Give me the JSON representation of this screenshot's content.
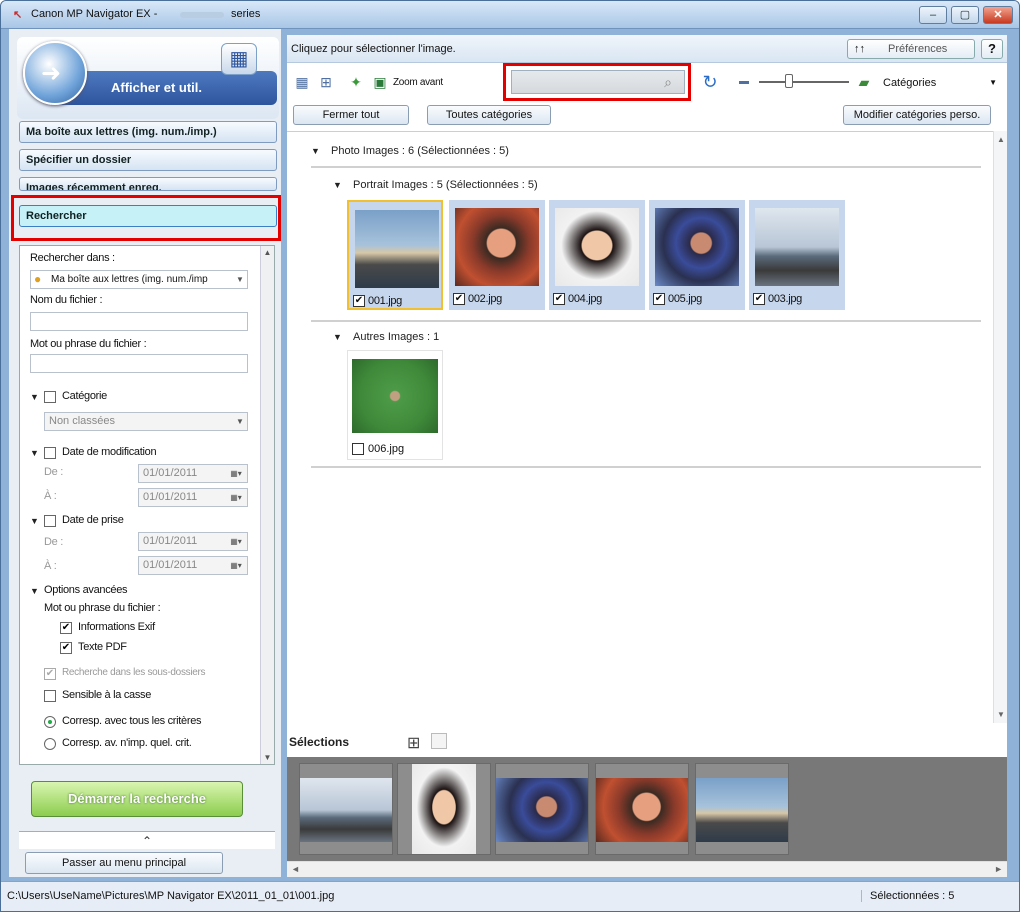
{
  "window": {
    "title": "Canon MP Navigator EX -",
    "title_suffix": "series",
    "btn_min": "–",
    "btn_max": "▢",
    "btn_close": "✕"
  },
  "left": {
    "header_label": "Afficher et util.",
    "nav": [
      {
        "label": "Ma boîte aux lettres (img. num./imp.)"
      },
      {
        "label": "Spécifier un dossier"
      },
      {
        "label": "Images récemment enreg."
      },
      {
        "label": "Rechercher"
      }
    ],
    "search": {
      "look_in_label": "Rechercher dans :",
      "look_in_value": "Ma boîte aux lettres (img. num./imp",
      "filename_label": "Nom du fichier :",
      "phrase_label": "Mot ou phrase du fichier :",
      "category_label": "Catégorie",
      "category_value": "Non classées",
      "modified_label": "Date de modification",
      "from_label": "De :",
      "to_label": "À :",
      "date_value": "01/01/2011",
      "taken_label": "Date de prise",
      "advanced_label": "Options avancées",
      "adv_phrase_label": "Mot ou phrase du fichier :",
      "exif_label": "Informations Exif",
      "pdf_label": "Texte PDF",
      "subfolders_label": "Recherche dans les sous-dossiers",
      "case_label": "Sensible à la casse",
      "match_all_label": "Corresp. avec tous les critères",
      "match_any_label": "Corresp. av. n'imp. quel. crit."
    },
    "start_button": "Démarrer la recherche",
    "collapse_glyph": "⌃",
    "main_menu_button": "Passer au menu principal"
  },
  "right": {
    "instruction": "Cliquez pour sélectionner l'image.",
    "preferences": "Préférences",
    "preferences_icon": "↑↑",
    "help": "?",
    "zoom_in": "Zoom avant",
    "category_select": "Catégories",
    "close_all": "Fermer tout",
    "all_categories": "Toutes catégories",
    "edit_categories": "Modifier catégories perso.",
    "groups": {
      "photo": "Photo   Images : 6   (Sélectionnées : 5)",
      "portrait": "Portrait   Images : 5   (Sélectionnées : 5)",
      "others": "Autres   Images : 1"
    },
    "thumbnails": [
      {
        "name": "001.jpg",
        "checked": true
      },
      {
        "name": "002.jpg",
        "checked": true
      },
      {
        "name": "004.jpg",
        "checked": true
      },
      {
        "name": "005.jpg",
        "checked": true
      },
      {
        "name": "003.jpg",
        "checked": true
      },
      {
        "name": "006.jpg",
        "checked": false
      }
    ],
    "selections_label": "Sélections"
  },
  "status": {
    "path": "C:\\Users\\UseName\\Pictures\\MP Navigator EX\\2011_01_01\\001.jpg",
    "selected": "Sélectionnées : 5"
  },
  "colors": {
    "highlight_red": "#e50000",
    "selected_nav": "#c6f1f7",
    "start_button_green": "#8ccd4e"
  }
}
